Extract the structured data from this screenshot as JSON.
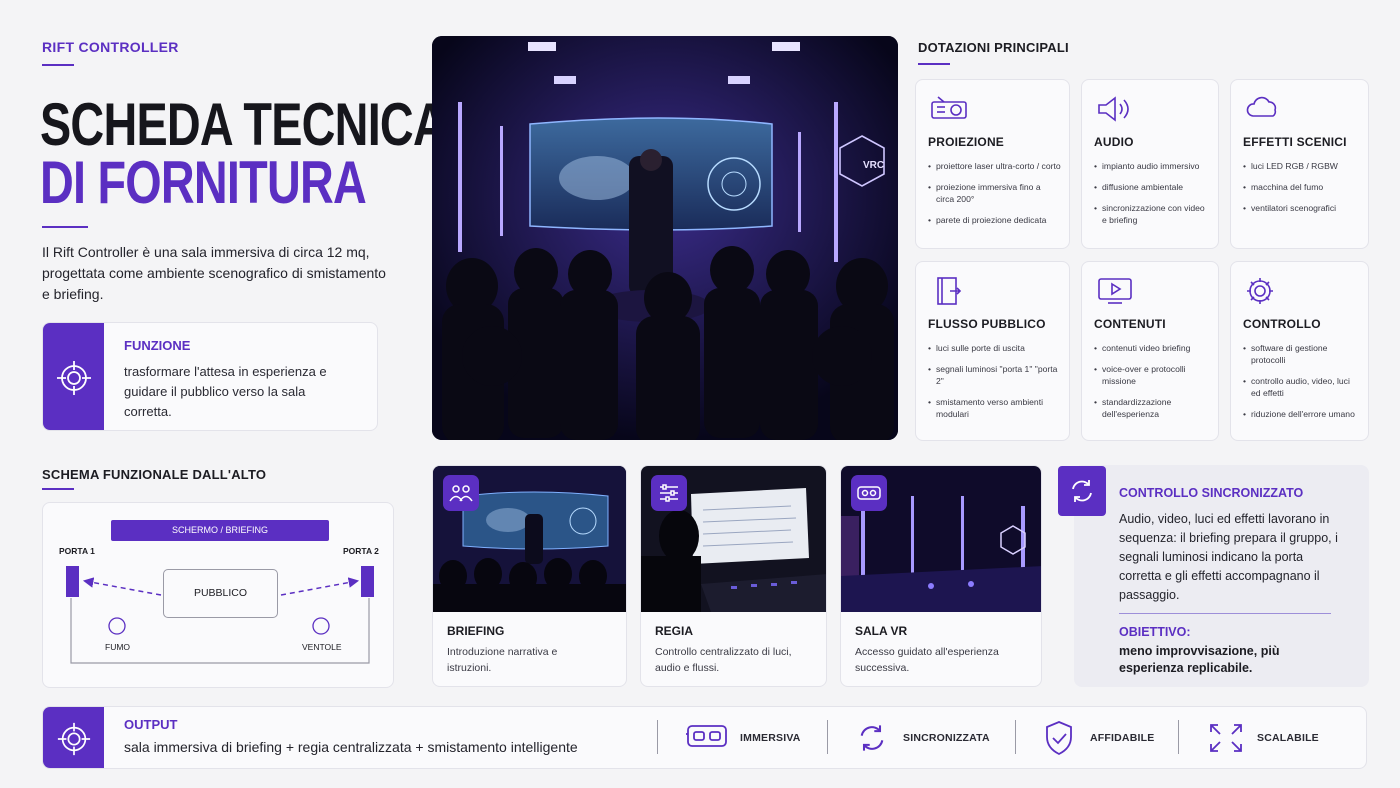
{
  "brand": "RIFT CONTROLLER",
  "title": {
    "line1": "SCHEDA TECNICA",
    "line2": "DI FORNITURA"
  },
  "intro": "Il Rift Controller è una sala immersiva di circa 12 mq, progettata come ambiente scenografico di smistamento e briefing.",
  "funzione": {
    "title": "FUNZIONE",
    "text": "trasformare l'attesa in esperienza e guidare il pubblico verso la sala corretta."
  },
  "schema": {
    "title": "SCHEMA FUNZIONALE DALL'ALTO",
    "screen": "SCHERMO / BRIEFING",
    "porta1": "PORTA 1",
    "porta2": "PORTA 2",
    "pubblico": "PUBBLICO",
    "fumo": "FUMO",
    "ventole": "VENTOLE"
  },
  "dotazioni": {
    "title": "DOTAZIONI PRINCIPALI",
    "items": [
      {
        "title": "PROIEZIONE",
        "icon": "projector-icon",
        "bullets": [
          "proiettore laser ultra-corto / corto",
          "proiezione immersiva fino a circa 200°",
          "parete di proiezione dedicata"
        ]
      },
      {
        "title": "AUDIO",
        "icon": "speaker-icon",
        "bullets": [
          "impianto audio immersivo",
          "diffusione ambientale",
          "sincronizzazione con video e briefing"
        ]
      },
      {
        "title": "EFFETTI SCENICI",
        "icon": "cloud-icon",
        "bullets": [
          "luci LED RGB / RGBW",
          "macchina del fumo",
          "ventilatori scenografici"
        ]
      },
      {
        "title": "FLUSSO PUBBLICO",
        "icon": "door-icon",
        "bullets": [
          "luci sulle porte di uscita",
          "segnali luminosi \"porta 1\" \"porta 2\"",
          "smistamento verso ambienti modulari"
        ]
      },
      {
        "title": "CONTENUTI",
        "icon": "play-screen-icon",
        "bullets": [
          "contenuti video briefing",
          "voice-over e protocolli missione",
          "standardizzazione dell'esperienza"
        ]
      },
      {
        "title": "CONTROLLO",
        "icon": "gear-icon",
        "bullets": [
          "software di gestione protocolli",
          "controllo audio, video, luci ed effetti",
          "riduzione dell'errore umano"
        ]
      }
    ]
  },
  "gallery": [
    {
      "title": "BRIEFING",
      "text": "Introduzione narrativa e istruzioni.",
      "icon": "people-icon"
    },
    {
      "title": "REGIA",
      "text": "Controllo centralizzato di luci, audio e flussi.",
      "icon": "sliders-icon"
    },
    {
      "title": "SALA VR",
      "text": "Accesso guidato all'esperienza successiva.",
      "icon": "vr-headset-icon"
    }
  ],
  "sync": {
    "title": "CONTROLLO SINCRONIZZATO",
    "text": "Audio, video, luci ed effetti lavorano in sequenza: il briefing prepara il gruppo, i segnali luminosi indicano la porta corretta e gli effetti accompagnano il passaggio.",
    "obiettivo_label": "OBIETTIVO:",
    "obiettivo_text": "meno improvvisazione, più esperienza replicabile."
  },
  "output": {
    "title": "OUTPUT",
    "text": "sala immersiva di briefing + regia centralizzata + smistamento intelligente",
    "badges": [
      {
        "label": "IMMERSIVA",
        "icon": "vr-headset-icon"
      },
      {
        "label": "SINCRONIZZATA",
        "icon": "sync-icon"
      },
      {
        "label": "AFFIDABILE",
        "icon": "shield-check-icon"
      },
      {
        "label": "SCALABILE",
        "icon": "expand-icon"
      }
    ]
  },
  "vrc_logo": "VRC",
  "colors": {
    "accent": "#5b2fc2",
    "background": "#f4f4f6",
    "dark": "#1c1c22"
  }
}
